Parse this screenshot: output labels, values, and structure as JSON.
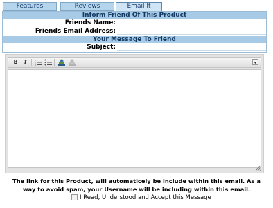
{
  "tabs": [
    {
      "label": "Features"
    },
    {
      "label": "Reviews"
    },
    {
      "label": "Email It"
    }
  ],
  "inform": {
    "header": "Inform Friend Of This Product",
    "friends_name_label": "Friends Name:",
    "friends_email_label": "Friends Email Address:"
  },
  "message": {
    "header": "Your Message To Friend",
    "subject_label": "Subject:"
  },
  "editor": {
    "toolbar": {
      "bold": "B",
      "italic": "I",
      "icons": [
        "numbered-list-icon",
        "bulleted-list-icon",
        "link-icon",
        "unlink-icon",
        "expand-icon"
      ]
    },
    "content": ""
  },
  "notice": "The link for this Product, will automaticely be include within this email. As a way to avoid spam, your Username will be including within this email.",
  "accept_label": "I Read, Understood and Accept this Message",
  "colors": {
    "band": "#a7cbe7",
    "tab": "#b5d5ec"
  }
}
